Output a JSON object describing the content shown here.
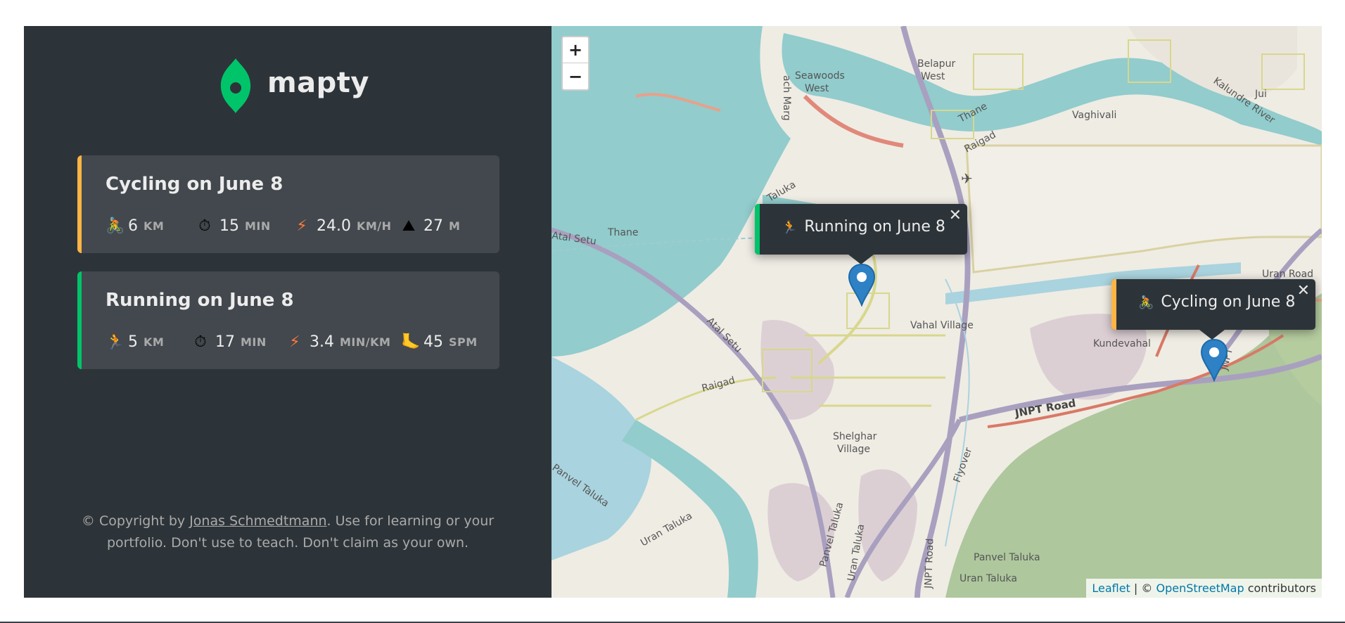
{
  "app": {
    "logo_text": "mapty",
    "brand_color": "#00c46a",
    "cycling_color": "#ffb545",
    "running_color": "#00c46a"
  },
  "workouts": [
    {
      "type": "cycling",
      "title": "Cycling on June 8",
      "stats": [
        {
          "icon": "cycling-icon",
          "glyph": "🚴",
          "value": "6",
          "unit": "KM"
        },
        {
          "icon": "stopwatch-icon",
          "glyph": "⏱",
          "value": "15",
          "unit": "MIN"
        },
        {
          "icon": "lightning-icon",
          "glyph": "⚡",
          "value": "24.0",
          "unit": "KM/H"
        },
        {
          "icon": "mountain-icon",
          "glyph": "⛰",
          "value": "27",
          "unit": "M"
        }
      ]
    },
    {
      "type": "running",
      "title": "Running on June 8",
      "stats": [
        {
          "icon": "running-icon",
          "glyph": "🏃",
          "value": "5",
          "unit": "KM"
        },
        {
          "icon": "stopwatch-icon",
          "glyph": "⏱",
          "value": "17",
          "unit": "MIN"
        },
        {
          "icon": "lightning-icon",
          "glyph": "⚡",
          "value": "3.4",
          "unit": "MIN/KM"
        },
        {
          "icon": "footprint-icon",
          "glyph": "🦶",
          "value": "45",
          "unit": "SPM"
        }
      ]
    }
  ],
  "footer": {
    "prefix": "© Copyright by ",
    "author_link": "Jonas Schmedtmann",
    "suffix": ". Use for learning or your portfolio. Don't use to teach. Don't claim as your own."
  },
  "map": {
    "zoom_in_label": "+",
    "zoom_out_label": "−",
    "popups": [
      {
        "type": "running",
        "glyph": "🏃",
        "text": "Running on June 8",
        "close": "✕"
      },
      {
        "type": "cycling",
        "glyph": "🚴",
        "text": "Cycling on June 8",
        "close": "✕"
      }
    ],
    "labels": {
      "seawoods": "Seawoods",
      "west1": "West",
      "belapur": "Belapur",
      "west2": "West",
      "vaghivali": "Vaghivali",
      "jui": "Jui",
      "thane1": "Thane",
      "raigad1": "Raigad",
      "thane2": "Thane",
      "atal_setu1": "Atal Setu",
      "taluka": "Taluka",
      "atal_setu2": "Atal Setu",
      "raigad2": "Raigad",
      "vahal": "Vahal Village",
      "kundevahal": "Kundevahal",
      "jnpt_road": "JNPT Road",
      "uran_road": "Uran Road",
      "shelghar1": "Shelghar",
      "shelghar2": "Village",
      "flyover": "Flyover",
      "panvel_taluka1": "Panvel Taluka",
      "uran_taluka1": "Uran Taluka",
      "panvel_taluka2": "Panvel Taluka",
      "uran_taluka2": "Uran Taluka",
      "jnpt_road2": "JNPT Road",
      "panvel_taluka3": "Panvel Taluka",
      "uran_taluka3": "Uran Taluka",
      "marg": "ach Marg",
      "kalundre": "Kalundre River",
      "jnpt": "JNPT"
    },
    "attribution": {
      "leaflet": "Leaflet",
      "separator": " | © ",
      "osm": "OpenStreetMap",
      "suffix": " contributors"
    }
  }
}
